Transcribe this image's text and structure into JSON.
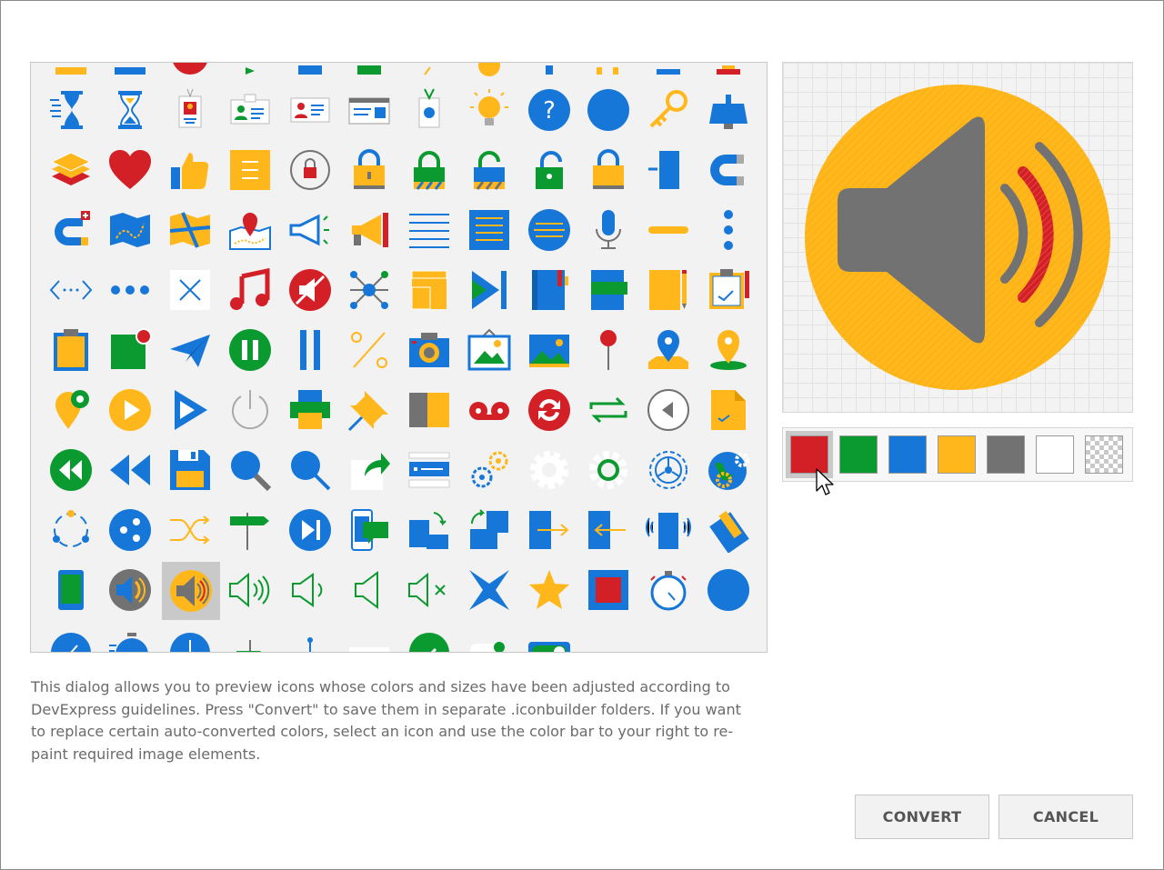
{
  "dialog": {
    "description": "This dialog allows you to preview icons whose colors and sizes have been adjusted according to DevExpress guidelines. Press \"Convert\" to save them in separate .iconbuilder folders. If you want to replace certain auto-converted colors, select an icon and use the color bar to your right to re-paint required image elements.",
    "convert_label": "CONVERT",
    "cancel_label": "CANCEL"
  },
  "colors": {
    "red": "#d32027",
    "green": "#0a9a2f",
    "blue": "#1677d8",
    "yellow": "#ffb71b",
    "gray": "#727272",
    "white": "#ffffff"
  },
  "color_bar": [
    {
      "name": "red",
      "color": "#d32027",
      "active": true
    },
    {
      "name": "green",
      "color": "#0a9a2f",
      "active": false
    },
    {
      "name": "blue",
      "color": "#1677d8",
      "active": false
    },
    {
      "name": "yellow",
      "color": "#ffb71b",
      "active": false
    },
    {
      "name": "gray",
      "color": "#727272",
      "active": false
    },
    {
      "name": "white",
      "color": "#ffffff",
      "active": false
    },
    {
      "name": "transparent",
      "color": "transparent",
      "active": false
    }
  ],
  "preview": {
    "icon": "volume-speaker-icon"
  },
  "gallery": {
    "selected": "volume-speaker-yellow-icon",
    "rows": [
      [
        "partial-icon",
        "partial-icon",
        "partial-icon",
        "partial-icon",
        "partial-icon",
        "partial-icon",
        "partial-icon",
        "partial-icon",
        "partial-icon",
        "partial-icon",
        "partial-icon",
        "partial-icon"
      ],
      [
        "hourglass-lines-icon",
        "hourglass-icon",
        "id-badge-icon",
        "id-card-icon",
        "contact-card-icon",
        "business-card-icon",
        "name-badge-icon",
        "lightbulb-icon",
        "help-circle-icon",
        "blue-circle-icon",
        "key-icon",
        "desk-lamp-icon"
      ],
      [
        "layers-icon",
        "heart-icon",
        "thumbs-up-icon",
        "note-icon",
        "lock-refresh-icon",
        "lock-icon",
        "lock-green-icon",
        "unlock-icon",
        "padlock-open-icon",
        "padlock-icon",
        "door-icon",
        "magnet-icon"
      ],
      [
        "magnet-plus-icon",
        "map-icon",
        "folded-map-icon",
        "map-pin-icon",
        "megaphone-icon",
        "loudspeaker-icon",
        "lines-icon",
        "text-block-icon",
        "rounded-text-icon",
        "microphone-icon",
        "minus-icon",
        "vertical-dots-icon"
      ],
      [
        "code-icon",
        "horizontal-dots-icon",
        "close-icon",
        "music-note-icon",
        "mute-icon",
        "network-icon",
        "box-icon",
        "next-track-icon",
        "notebook-icon",
        "green-notebook-icon",
        "notepad-icon",
        "clipboard-icon"
      ],
      [
        "orange-clipboard-icon",
        "notification-icon",
        "paper-plane-icon",
        "pause-circle-icon",
        "pause-icon",
        "percent-icon",
        "camera-icon",
        "picture-icon",
        "image-icon",
        "pushpin-icon",
        "location-map-icon",
        "location-pin-icon"
      ],
      [
        "location-check-icon",
        "play-circle-icon",
        "play-icon",
        "power-icon",
        "printer-icon",
        "pin-icon",
        "book-icon",
        "voicemail-icon",
        "refresh-icon",
        "repeat-icon",
        "back-circle-icon",
        "document-icon"
      ],
      [
        "rewind-circle-icon",
        "rewind-icon",
        "save-icon",
        "search-icon",
        "zoom-icon",
        "share-icon",
        "server-icon",
        "settings-gears-icon",
        "gear-icon",
        "gear-green-icon",
        "gear-outline-icon",
        "globe-gear-icon"
      ],
      [
        "share-nodes-icon",
        "share-circle-icon",
        "shuffle-icon",
        "signpost-icon",
        "skip-next-icon",
        "mobile-message-icon",
        "tablet-rotate-icon",
        "tablet-rotate-blue-icon",
        "tablet-import-icon",
        "tablet-export-icon",
        "tablet-vibrate-icon",
        "tablet-pencil-icon"
      ],
      [
        "smartphone-icon",
        "volume-speaker-blue-icon",
        "volume-speaker-yellow-icon",
        "volume-up-icon",
        "volume-medium-icon",
        "volume-low-icon",
        "volume-mute-icon",
        "x-icon",
        "star-icon",
        "stop-square-icon",
        "stopwatch-icon",
        "blue-dot-icon"
      ],
      [
        "clock-icon",
        "timer-icon",
        "clock-blue-icon",
        "signpost-green-icon",
        "signpost-green2-icon",
        "line-icon",
        "check-icon",
        "toggle-icon",
        "switch-icon",
        "toggle-gray-icon",
        "toggle-gray2-icon",
        "toggle-blue-icon"
      ]
    ]
  }
}
